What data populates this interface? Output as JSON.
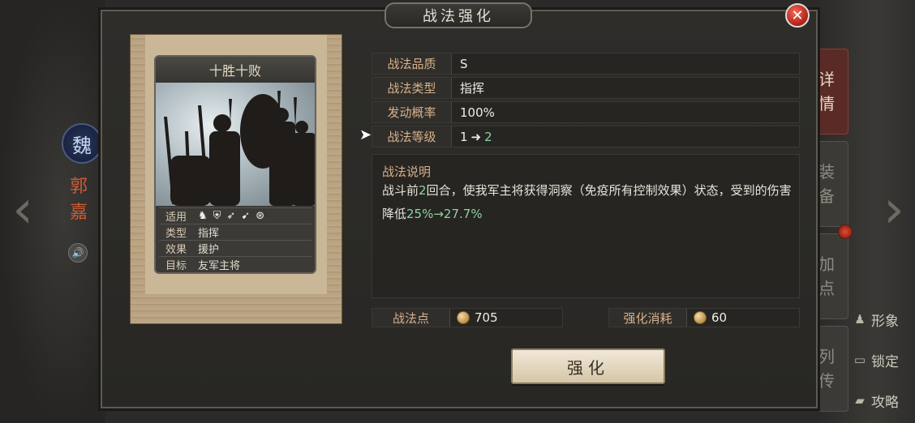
{
  "header": {
    "title": "战法强化"
  },
  "general": {
    "faction": "魏",
    "name": "郭嘉"
  },
  "side_tabs": [
    {
      "label": "详情",
      "active": true
    },
    {
      "label": "装备",
      "active": false
    },
    {
      "label": "加点",
      "active": false
    },
    {
      "label": "列传",
      "active": false
    }
  ],
  "right_actions": [
    {
      "icon": "person-icon",
      "label": "形象"
    },
    {
      "icon": "lock-icon",
      "label": "锁定"
    },
    {
      "icon": "book-icon",
      "label": "攻略"
    }
  ],
  "card": {
    "name": "十胜十败",
    "info": [
      {
        "key": "适用",
        "value": ""
      },
      {
        "key": "类型",
        "value": "指挥"
      },
      {
        "key": "效果",
        "value": "援护"
      },
      {
        "key": "目标",
        "value": "友军主将"
      }
    ],
    "unit_icons": [
      "cavalry-icon",
      "shield-icon",
      "bow-icon",
      "spear-icon",
      "wheel-icon"
    ]
  },
  "attributes": [
    {
      "key": "战法品质",
      "value": "S"
    },
    {
      "key": "战法类型",
      "value": "指挥"
    },
    {
      "key": "发动概率",
      "value": "100%"
    },
    {
      "key": "战法等级",
      "from": "1",
      "to": "2"
    }
  ],
  "description": {
    "title": "战法说明",
    "pre": "战斗前",
    "rounds": "2",
    "mid": "回合，使我军主将获得洞察（免疫所有控制效果）状态，受到的伤害降低",
    "value_change": "25%→27.7%"
  },
  "costs": {
    "points_label": "战法点",
    "points_value": "705",
    "consume_label": "强化消耗",
    "consume_value": "60"
  },
  "actions": {
    "enhance_label": "强化"
  },
  "colors": {
    "accent": "#d8b18a",
    "highlight": "#8ed2a2",
    "close": "#c8261b"
  }
}
